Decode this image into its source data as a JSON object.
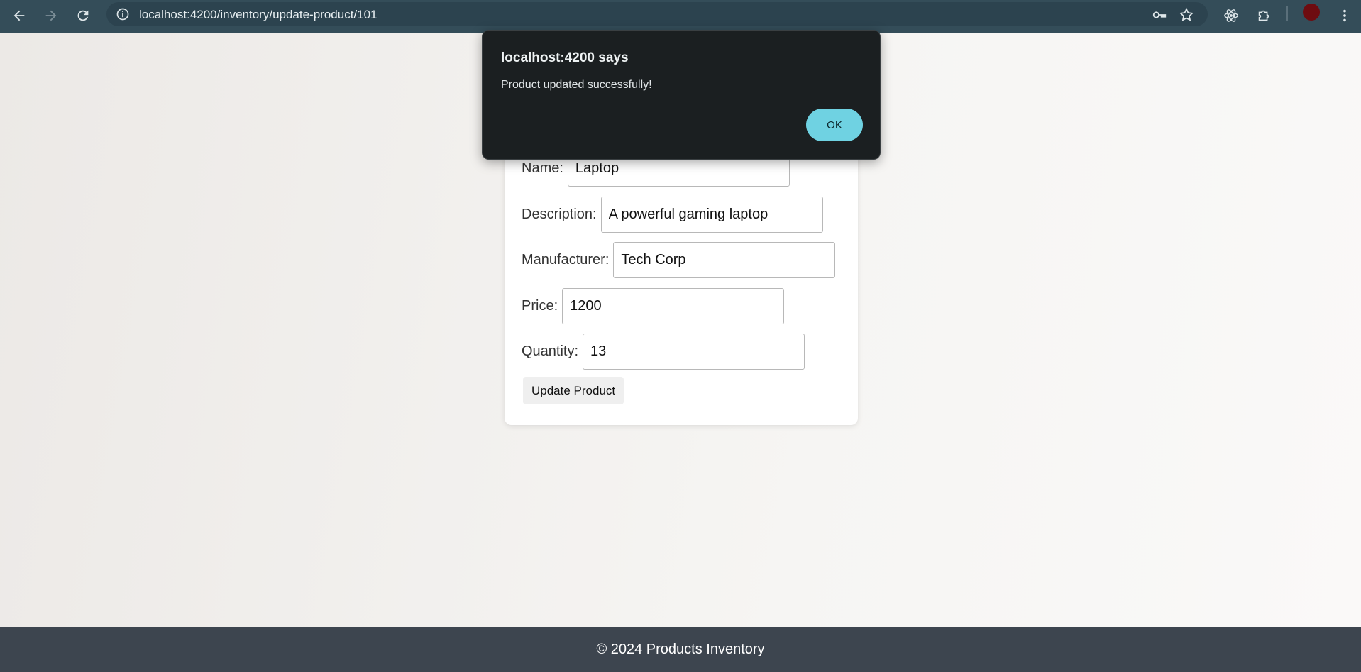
{
  "browser": {
    "url": "localhost:4200/inventory/update-product/101",
    "icons": [
      "back-arrow-icon",
      "forward-arrow-icon",
      "reload-icon",
      "site-info-icon",
      "key-icon",
      "star-icon",
      "react-icon",
      "extensions-icon",
      "menu-icon"
    ],
    "avatar_color": "#6e0c10"
  },
  "form": {
    "fields": [
      {
        "label": "Name:",
        "value": "Laptop"
      },
      {
        "label": "Description:",
        "value": "A powerful gaming laptop"
      },
      {
        "label": "Manufacturer:",
        "value": "Tech Corp"
      },
      {
        "label": "Price:",
        "value": "1200"
      },
      {
        "label": "Quantity:",
        "value": "13"
      }
    ],
    "submit_label": "Update Product"
  },
  "footer": {
    "text": "© 2024 Products Inventory"
  },
  "dialog": {
    "title": "localhost:4200 says",
    "message": "Product updated successfully!",
    "ok_label": "OK",
    "accent": "#6fd2e2"
  }
}
